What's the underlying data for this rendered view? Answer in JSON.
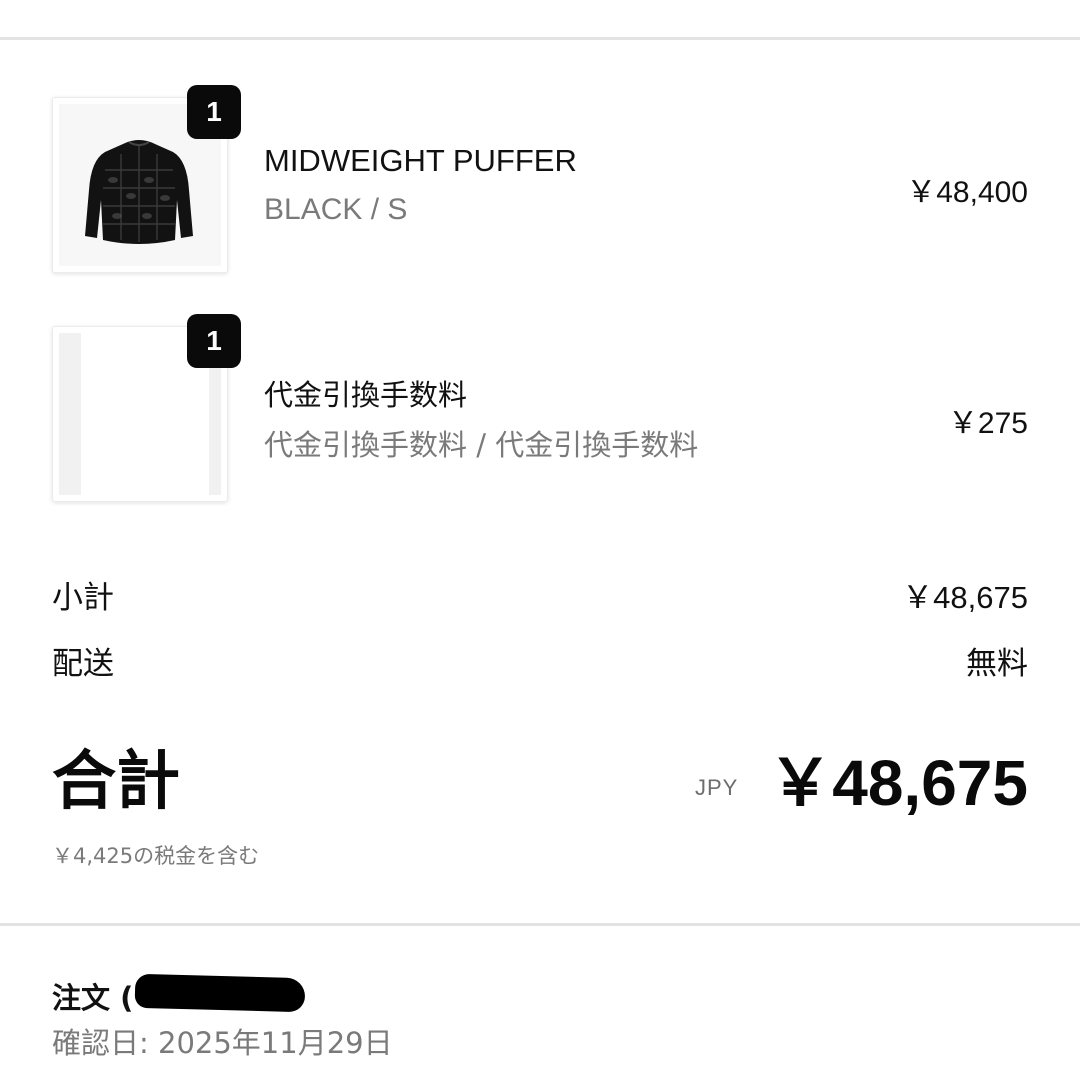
{
  "line_items": [
    {
      "quantity": "1",
      "name": "MIDWEIGHT PUFFER",
      "variant": "BLACK / S",
      "price": "￥48,400",
      "thumbnail": "black-puffer-jacket"
    },
    {
      "quantity": "1",
      "name": "代金引換手数料",
      "variant": "代金引換手数料 / 代金引換手数料",
      "price": "￥275",
      "thumbnail": "blank"
    }
  ],
  "summary": {
    "subtotal_label": "小計",
    "subtotal_value": "￥48,675",
    "shipping_label": "配送",
    "shipping_value": "無料",
    "total_label": "合計",
    "total_currency": "JPY",
    "total_value": "￥48,675",
    "tax_note": "￥4,425の税金を含む"
  },
  "order": {
    "title": "注文 (",
    "confirmed_date": "確認日: 2025年11月29日"
  },
  "colors": {
    "badge_background": "#0a0a0a",
    "text_primary": "#111111",
    "text_secondary": "#7a7a7a",
    "divider": "#e3e3e3"
  }
}
